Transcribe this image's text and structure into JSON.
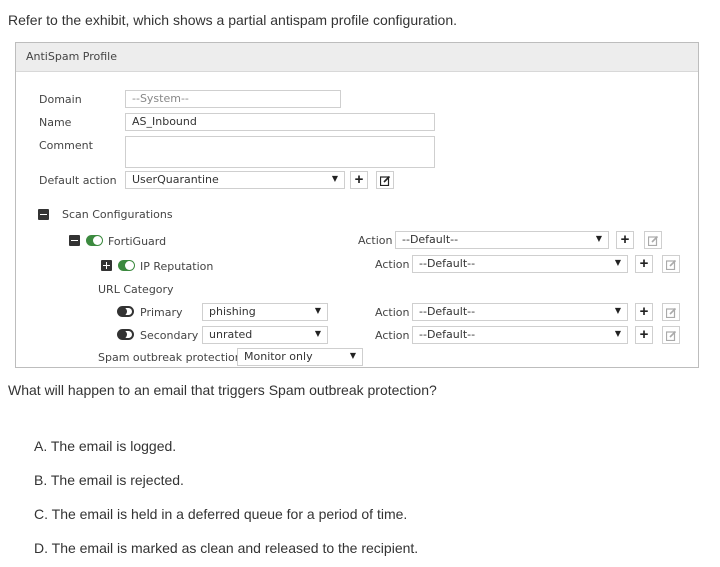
{
  "question": {
    "intro": "Refer to the exhibit, which shows a partial antispam profile configuration.",
    "prompt": "What will happen to an email that triggers Spam outbreak protection?",
    "options": [
      "A. The email is logged.",
      "B. The email is rejected.",
      "C. The email is held in a deferred queue for a period of time.",
      "D. The email is marked as clean and released to the recipient."
    ]
  },
  "profile": {
    "title": "AntiSpam Profile",
    "domain_label": "Domain",
    "domain_value": "--System--",
    "name_label": "Name",
    "name_value": "AS_Inbound",
    "comment_label": "Comment",
    "comment_value": "",
    "default_action_label": "Default action",
    "default_action_value": "UserQuarantine",
    "scan_configurations_label": "Scan Configurations",
    "fortiguard_label": "FortiGuard",
    "fortiguard_action_label": "Action",
    "fortiguard_action_value": "--Default--",
    "ip_reputation_label": "IP Reputation",
    "ip_reputation_action_label": "Action",
    "ip_reputation_action_value": "--Default--",
    "url_category_label": "URL Category",
    "primary_label": "Primary",
    "primary_value": "phishing",
    "primary_action_label": "Action",
    "primary_action_value": "--Default--",
    "secondary_label": "Secondary",
    "secondary_value": "unrated",
    "secondary_action_label": "Action",
    "secondary_action_value": "--Default--",
    "spam_outbreak_label": "Spam outbreak protection",
    "spam_outbreak_value": "Monitor only"
  },
  "icons": {
    "add": "plus-icon",
    "edit": "edit-icon",
    "collapse": "minus-square-icon",
    "expand": "plus-square-icon",
    "toggle": "toggle-icon"
  },
  "colors": {
    "toggle_on": "#3c8a3f",
    "panel_header": "#ededed"
  }
}
